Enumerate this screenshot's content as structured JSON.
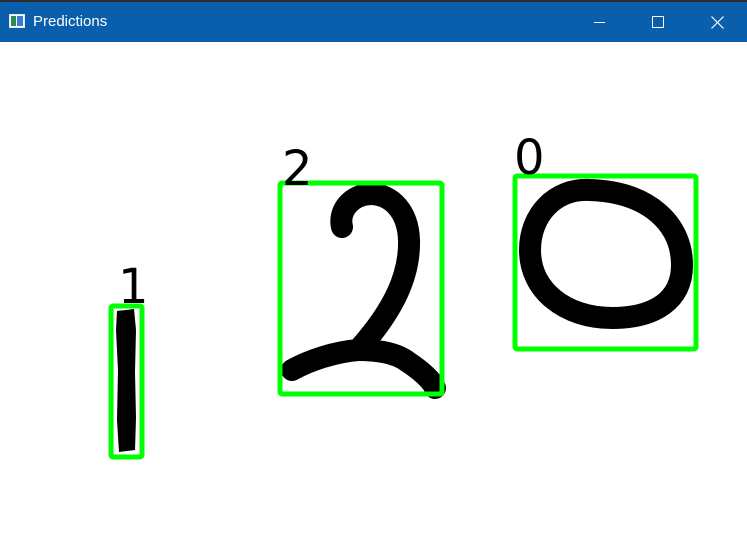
{
  "window": {
    "title": "Predictions",
    "titlebar_color": "#0a5fad",
    "controls": {
      "minimize_icon": "minimize-icon",
      "maximize_icon": "maximize-icon",
      "close_icon": "close-icon"
    }
  },
  "detections": [
    {
      "prediction": "1"
    },
    {
      "prediction": "2"
    },
    {
      "prediction": "0"
    }
  ],
  "colors": {
    "box": "#00ff00",
    "ink": "#000000",
    "background": "#ffffff"
  }
}
